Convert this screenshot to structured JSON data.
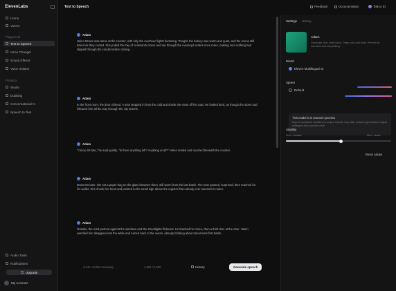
{
  "sidebar": {
    "brand": "ElevenLabs",
    "top_items": [
      {
        "label": "Home"
      },
      {
        "label": "Voices"
      }
    ],
    "playground_label": "Playground",
    "playground_items": [
      {
        "label": "Text to Speech",
        "active": true
      },
      {
        "label": "Voice Changer"
      },
      {
        "label": "Sound Effects"
      },
      {
        "label": "Voice Isolator"
      }
    ],
    "products_label": "Products",
    "product_items": [
      {
        "label": "Studio"
      },
      {
        "label": "Dubbing"
      },
      {
        "label": "Conversational AI"
      },
      {
        "label": "Speech to Text"
      }
    ],
    "bottom_items": [
      {
        "label": "Audio Tools"
      },
      {
        "label": "Notifications"
      }
    ],
    "upgrade_label": "Upgrade",
    "user_name": "My Account"
  },
  "header": {
    "title": "Text to Speech",
    "feedback": "Feedback",
    "documentation": "Documentation",
    "talk_to": "Talk to El"
  },
  "transcript": {
    "turns": [
      {
        "speaker": "Adam",
        "text": "Helen Brown was alone at the counter, with only the overhead lights humming. Tonight, the bakery was warm and quiet, and the ovens still ticked as they cooled. She pulled the tray of croissants closer and ran through the evening's orders once more, making sure nothing had slipped through the cracks before closing."
      },
      {
        "speaker": "Adam",
        "text": "In the front room, the door chimed. A man stepped in from the cold and shook the snow off his coat. He looked tired, as though the storm had followed him all the way through the city streets."
      },
      {
        "speaker": "Adam",
        "text": "\"I know it's late,\" he said quietly. \"Is there anything left? Anything at all?\" Helen smiled and reached beneath the counter."
      },
      {
        "speaker": "Adam",
        "text": "Moments later, she set a paper bag on the glass between them, still warm from the last batch. The man paused, surprised, then reached for his wallet. She shook her head and pointed to the small sign above the register that nobody ever seemed to notice."
      },
      {
        "speaker": "Adam",
        "text": "Outside, the wind pushed against the windows and the streetlights flickered. He thanked her twice, then a third time at the door. Helen watched him disappear into the white and turned back to the ovens, already thinking about tomorrow's first batch."
      }
    ]
  },
  "bottombar": {
    "credits": "2,341 credits remaining",
    "chars": "1,054 / 5,000",
    "history": "History",
    "generate": "Generate speech"
  },
  "panel": {
    "tabs": [
      "Settings",
      "History"
    ],
    "voice_name": "Adam",
    "voice_desc": "Dominant, firm male voice. Deep, rich and clear. Perfect for narration and storytelling.",
    "model_label": "Model",
    "model_value": "Eleven Multilingual v2",
    "speed_label": "Speed",
    "speed_value": "Default",
    "notice_title": "This model is in research preview",
    "notice_body": "Expect occasional variations in output. Results may differ between generations. Adjust settings to fine-tune the voice.",
    "stability_label": "Stability",
    "stability_min": "More variable",
    "stability_max": "More stable",
    "stability_level": 0.52,
    "reset": "Reset values"
  }
}
